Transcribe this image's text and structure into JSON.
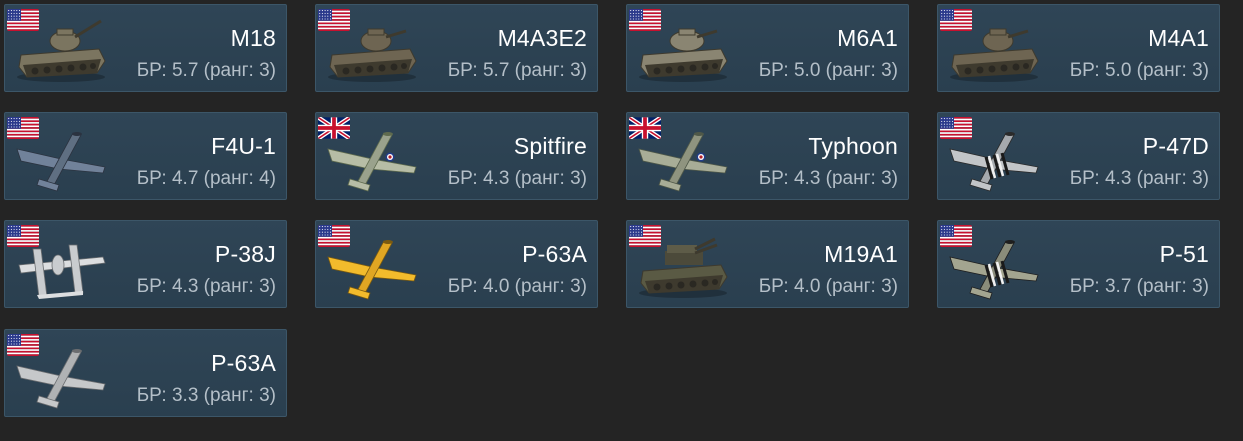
{
  "colors": {
    "background": "#242424",
    "card": "#2c4252",
    "card_border": "#3c5668",
    "name_text": "#ffffff",
    "br_text": "#b4bfc8"
  },
  "vehicles": [
    {
      "name": "M18",
      "br": "БР: 5.7 (ранг: 3)",
      "nation": "usa",
      "kind": "tank",
      "icon": "m18-tank-icon"
    },
    {
      "name": "M4A3E2",
      "br": "БР: 5.7 (ранг: 3)",
      "nation": "usa",
      "kind": "tank",
      "icon": "m4a3e2-tank-icon"
    },
    {
      "name": "M6A1",
      "br": "БР: 5.0 (ранг: 3)",
      "nation": "usa",
      "kind": "tank",
      "icon": "m6a1-tank-icon"
    },
    {
      "name": "M4A1",
      "br": "БР: 5.0 (ранг: 3)",
      "nation": "usa",
      "kind": "tank",
      "icon": "m4a1-tank-icon"
    },
    {
      "name": "F4U-1",
      "br": "БР: 4.7 (ранг: 4)",
      "nation": "usa",
      "kind": "plane",
      "icon": "f4u-plane-icon"
    },
    {
      "name": "Spitfire",
      "br": "БР: 4.3 (ранг: 3)",
      "nation": "uk",
      "kind": "plane",
      "icon": "spitfire-plane-icon"
    },
    {
      "name": "Typhoon",
      "br": "БР: 4.3 (ранг: 3)",
      "nation": "uk",
      "kind": "plane",
      "icon": "typhoon-plane-icon"
    },
    {
      "name": "P-47D",
      "br": "БР: 4.3 (ранг: 3)",
      "nation": "usa",
      "kind": "plane",
      "icon": "p47d-plane-icon"
    },
    {
      "name": "P-38J",
      "br": "БР: 4.3 (ранг: 3)",
      "nation": "usa",
      "kind": "plane",
      "icon": "p38j-plane-icon"
    },
    {
      "name": "P-63A",
      "br": "БР: 4.0 (ранг: 3)",
      "nation": "usa",
      "kind": "plane",
      "icon": "p63a-yellow-plane-icon"
    },
    {
      "name": "M19A1",
      "br": "БР: 4.0 (ранг: 3)",
      "nation": "usa",
      "kind": "tank",
      "icon": "m19a1-spaa-icon"
    },
    {
      "name": "P-51",
      "br": "БР: 3.7 (ранг: 3)",
      "nation": "usa",
      "kind": "plane",
      "icon": "p51-plane-icon"
    },
    {
      "name": "P-63A",
      "br": "БР: 3.3 (ранг: 3)",
      "nation": "usa",
      "kind": "plane",
      "icon": "p63a-plane-icon"
    }
  ]
}
